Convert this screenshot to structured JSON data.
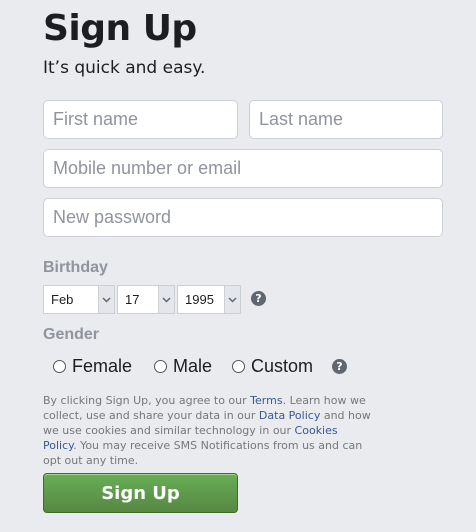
{
  "header": {
    "title": "Sign Up",
    "subtitle": "It’s quick and easy."
  },
  "form": {
    "first_name_placeholder": "First name",
    "last_name_placeholder": "Last name",
    "contact_placeholder": "Mobile number or email",
    "password_placeholder": "New password"
  },
  "birthday": {
    "label": "Birthday",
    "month": "Feb",
    "day": "17",
    "year": "1995",
    "help": "?"
  },
  "gender": {
    "label": "Gender",
    "options": [
      {
        "label": "Female"
      },
      {
        "label": "Male"
      },
      {
        "label": "Custom"
      }
    ],
    "help": "?"
  },
  "terms": {
    "t1": "By clicking Sign Up, you agree to our ",
    "link_terms": "Terms",
    "t2": ". Learn how we collect, use and share your data in our ",
    "link_data_policy": "Data Policy",
    "t3": " and how we use cookies and similar technology in our ",
    "link_cookies": "Cookies Policy",
    "t4": ". You may receive SMS Notifications from us and can opt out any time."
  },
  "submit": {
    "label": "Sign Up"
  },
  "colors": {
    "background": "#e9ebee",
    "button_green": "#5b9a47",
    "link": "#385898",
    "muted_label": "#90949c"
  }
}
